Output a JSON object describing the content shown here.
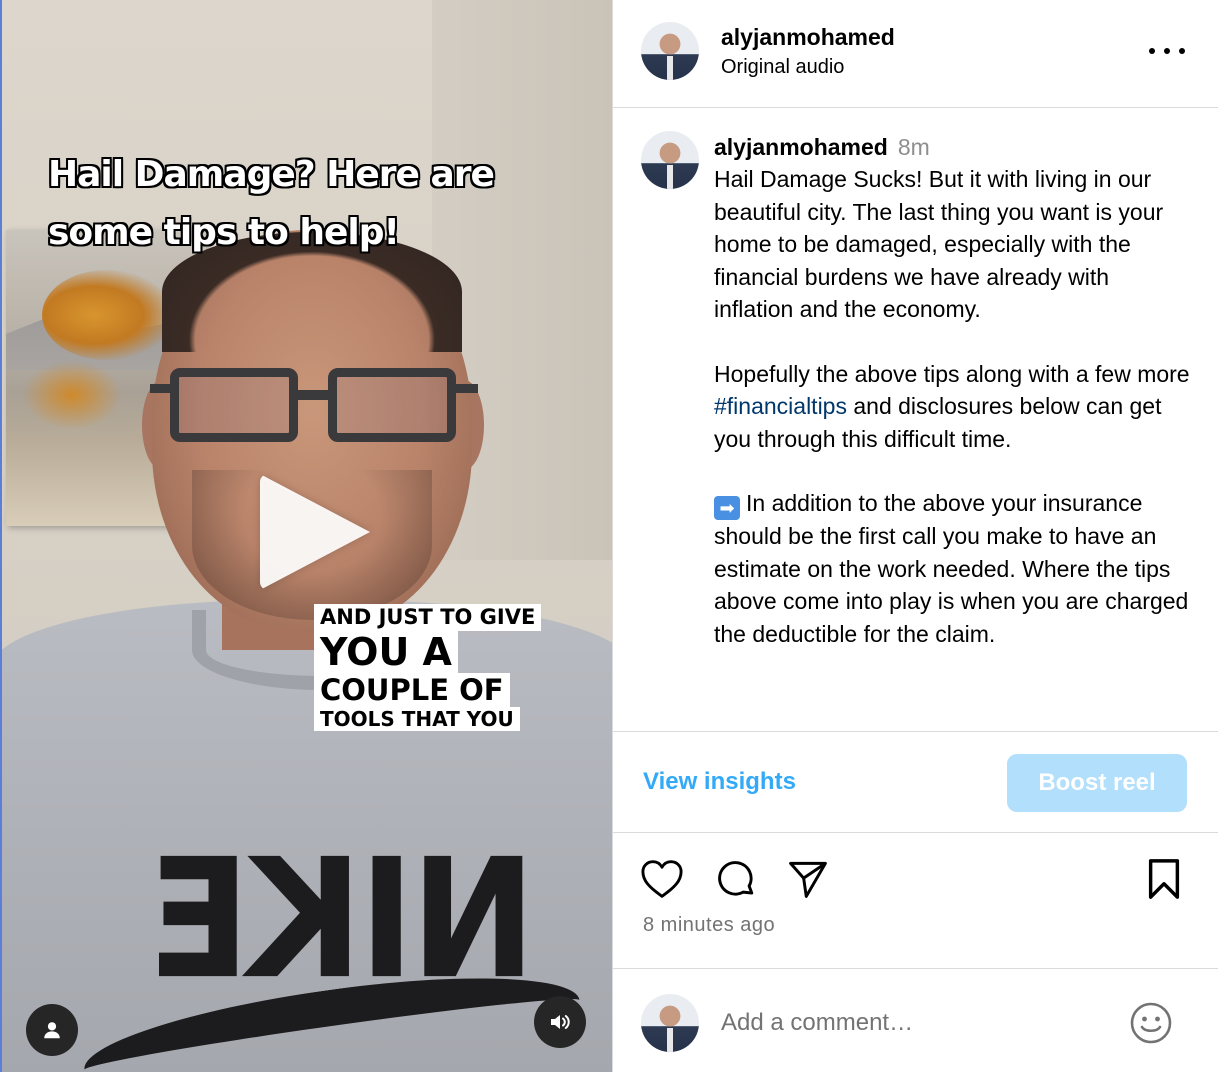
{
  "video": {
    "overlay_title": "Hail Damage? Here are some tips to help!",
    "caption_lines": [
      "AND JUST TO GIVE",
      "YOU A",
      "COUPLE OF",
      "TOOLS THAT YOU"
    ],
    "shirt_text": "NIKE"
  },
  "header": {
    "username": "alyjanmohamed",
    "audio": "Original audio"
  },
  "post": {
    "username": "alyjanmohamed",
    "time": "8m",
    "para1": "Hail Damage Sucks! But it with living in our beautiful city. The last thing you want is your home to be damaged, especially with the financial burdens we have already with inflation and the economy.",
    "para2_before": "Hopefully the above tips along with a few more ",
    "hashtag": "#financialtips",
    "para2_after": " and disclosures below can get you through this difficult time.",
    "arrow_emoji": "➡",
    "para3": "In addition to the above your insurance should be the first call you make to have an estimate on the work needed. Where the tips above come into play is when you are charged the deductible for the claim."
  },
  "actions": {
    "insights": "View insights",
    "boost": "Boost reel"
  },
  "meta": {
    "time_ago": "8 minutes ago"
  },
  "comment": {
    "placeholder": "Add a comment…"
  },
  "icons": [
    "user-icon",
    "sound-icon",
    "play-icon",
    "more-icon",
    "heart-icon",
    "comment-icon",
    "share-icon",
    "bookmark-icon",
    "emoji-icon"
  ],
  "colors": {
    "link": "#0095f6",
    "hashtag": "#00376b",
    "boost_bg": "#b2dffc",
    "muted": "#737373",
    "border": "#dbdbdb"
  }
}
